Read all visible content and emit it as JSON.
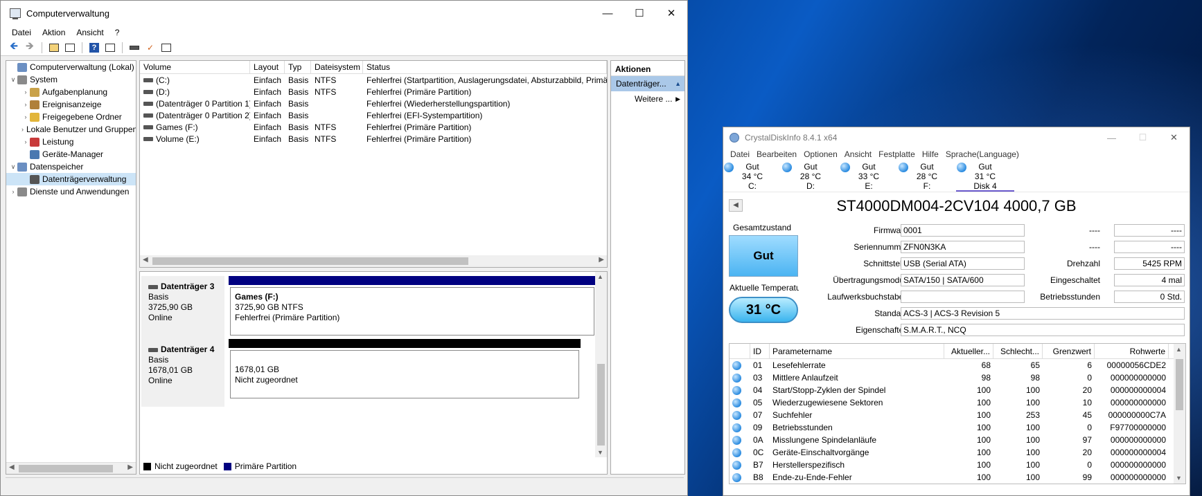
{
  "cv": {
    "title": "Computerverwaltung",
    "menu": [
      "Datei",
      "Aktion",
      "Ansicht",
      "?"
    ],
    "tree": [
      {
        "label": "Computerverwaltung (Lokal)",
        "level": 0,
        "exp": "",
        "icon": "#6b8fc2"
      },
      {
        "label": "System",
        "level": 0,
        "exp": "v",
        "icon": "#8a8a8a"
      },
      {
        "label": "Aufgabenplanung",
        "level": 1,
        "exp": ">",
        "icon": "#c9a24a"
      },
      {
        "label": "Ereignisanzeige",
        "level": 1,
        "exp": ">",
        "icon": "#b0803a"
      },
      {
        "label": "Freigegebene Ordner",
        "level": 1,
        "exp": ">",
        "icon": "#e2b53a"
      },
      {
        "label": "Lokale Benutzer und Gruppen",
        "level": 1,
        "exp": ">",
        "icon": "#6f9a3a"
      },
      {
        "label": "Leistung",
        "level": 1,
        "exp": ">",
        "icon": "#c83a3a"
      },
      {
        "label": "Geräte-Manager",
        "level": 1,
        "exp": "",
        "icon": "#4a78b0"
      },
      {
        "label": "Datenspeicher",
        "level": 0,
        "exp": "v",
        "icon": "#6b8fc2"
      },
      {
        "label": "Datenträgerverwaltung",
        "level": 1,
        "exp": "",
        "icon": "#555555"
      },
      {
        "label": "Dienste und Anwendungen",
        "level": 0,
        "exp": ">",
        "icon": "#8a8a8a"
      }
    ],
    "list_headers": [
      "Volume",
      "Layout",
      "Typ",
      "Dateisystem",
      "Status"
    ],
    "volumes": [
      {
        "volume": "(C:)",
        "layout": "Einfach",
        "typ": "Basis",
        "fs": "NTFS",
        "status": "Fehlerfrei (Startpartition, Auslagerungsdatei, Absturzabbild, Primä"
      },
      {
        "volume": "(D:)",
        "layout": "Einfach",
        "typ": "Basis",
        "fs": "NTFS",
        "status": "Fehlerfrei (Primäre Partition)"
      },
      {
        "volume": "(Datenträger 0 Partition 1)",
        "layout": "Einfach",
        "typ": "Basis",
        "fs": "",
        "status": "Fehlerfrei (Wiederherstellungspartition)"
      },
      {
        "volume": "(Datenträger 0 Partition 2)",
        "layout": "Einfach",
        "typ": "Basis",
        "fs": "",
        "status": "Fehlerfrei (EFI-Systempartition)"
      },
      {
        "volume": "Games (F:)",
        "layout": "Einfach",
        "typ": "Basis",
        "fs": "NTFS",
        "status": "Fehlerfrei (Primäre Partition)"
      },
      {
        "volume": "Volume (E:)",
        "layout": "Einfach",
        "typ": "Basis",
        "fs": "NTFS",
        "status": "Fehlerfrei (Primäre Partition)"
      }
    ],
    "disks": [
      {
        "name": "Datenträger 3",
        "type": "Basis",
        "size": "3725,90 GB",
        "state": "Online",
        "part_title": "Games  (F:)",
        "part_line1": "3725,90 GB NTFS",
        "part_line2": "Fehlerfrei (Primäre Partition)",
        "bar_color": "#000080"
      },
      {
        "name": "Datenträger 4",
        "type": "Basis",
        "size": "1678,01 GB",
        "state": "Online",
        "part_title": "",
        "part_line1": "1678,01 GB",
        "part_line2": "Nicht zugeordnet",
        "bar_color": "#000000"
      }
    ],
    "legend": [
      {
        "label": "Nicht zugeordnet",
        "color": "#000000"
      },
      {
        "label": "Primäre Partition",
        "color": "#000080"
      }
    ],
    "actions": {
      "header": "Aktionen",
      "selected": "Datenträger...",
      "more": "Weitere ..."
    }
  },
  "cdi": {
    "title": "CrystalDiskInfo 8.4.1 x64",
    "menu": [
      "Datei",
      "Bearbeiten",
      "Optionen",
      "Ansicht",
      "Festplatte",
      "Hilfe",
      "Sprache(Language)"
    ],
    "tabs": [
      {
        "status": "Gut",
        "temp": "34 °C",
        "drive": "C:"
      },
      {
        "status": "Gut",
        "temp": "28 °C",
        "drive": "D:"
      },
      {
        "status": "Gut",
        "temp": "33 °C",
        "drive": "E:"
      },
      {
        "status": "Gut",
        "temp": "28 °C",
        "drive": "F:"
      },
      {
        "status": "Gut",
        "temp": "31 °C",
        "drive": "Disk 4"
      }
    ],
    "model": "ST4000DM004-2CV104 4000,7 GB",
    "health_label": "Gesamtzustand",
    "health": "Gut",
    "temp_label": "Aktuelle Temperatur",
    "temp": "31 °C",
    "info": {
      "firmware_label": "Firmware",
      "firmware": "0001",
      "serial_label": "Seriennummer",
      "serial": "ZFN0N3KA",
      "interface_label": "Schnittstelle",
      "interface": "USB (Serial ATA)",
      "transfer_label": "Übertragungsmodus",
      "transfer": "SATA/150 | SATA/600",
      "letters_label": "Laufwerksbuchstaben",
      "letters": "",
      "standard_label": "Standard",
      "standard": "ACS-3 | ACS-3 Revision 5",
      "features_label": "Eigenschaften",
      "features": "S.M.A.R.T., NCQ",
      "r1_label": "----",
      "r1": "----",
      "r2_label": "----",
      "r2": "----",
      "rpm_label": "Drehzahl",
      "rpm": "5425 RPM",
      "power_on_count_label": "Eingeschaltet",
      "power_on_count": "4 mal",
      "power_on_hours_label": "Betriebsstunden",
      "power_on_hours": "0 Std."
    },
    "smart_headers": [
      "ID",
      "Parametername",
      "Aktueller...",
      "Schlecht...",
      "Grenzwert",
      "Rohwerte"
    ],
    "smart": [
      {
        "id": "01",
        "name": "Lesefehlerrate",
        "cur": "68",
        "worst": "65",
        "thr": "6",
        "raw": "00000056CDE2"
      },
      {
        "id": "03",
        "name": "Mittlere Anlaufzeit",
        "cur": "98",
        "worst": "98",
        "thr": "0",
        "raw": "000000000000"
      },
      {
        "id": "04",
        "name": "Start/Stopp-Zyklen der Spindel",
        "cur": "100",
        "worst": "100",
        "thr": "20",
        "raw": "000000000004"
      },
      {
        "id": "05",
        "name": "Wiederzugewiesene Sektoren",
        "cur": "100",
        "worst": "100",
        "thr": "10",
        "raw": "000000000000"
      },
      {
        "id": "07",
        "name": "Suchfehler",
        "cur": "100",
        "worst": "253",
        "thr": "45",
        "raw": "000000000C7A"
      },
      {
        "id": "09",
        "name": "Betriebsstunden",
        "cur": "100",
        "worst": "100",
        "thr": "0",
        "raw": "F97700000000"
      },
      {
        "id": "0A",
        "name": "Misslungene Spindelanläufe",
        "cur": "100",
        "worst": "100",
        "thr": "97",
        "raw": "000000000000"
      },
      {
        "id": "0C",
        "name": "Geräte-Einschaltvorgänge",
        "cur": "100",
        "worst": "100",
        "thr": "20",
        "raw": "000000000004"
      },
      {
        "id": "B7",
        "name": "Herstellerspezifisch",
        "cur": "100",
        "worst": "100",
        "thr": "0",
        "raw": "000000000000"
      },
      {
        "id": "B8",
        "name": "Ende-zu-Ende-Fehler",
        "cur": "100",
        "worst": "100",
        "thr": "99",
        "raw": "000000000000"
      }
    ]
  }
}
